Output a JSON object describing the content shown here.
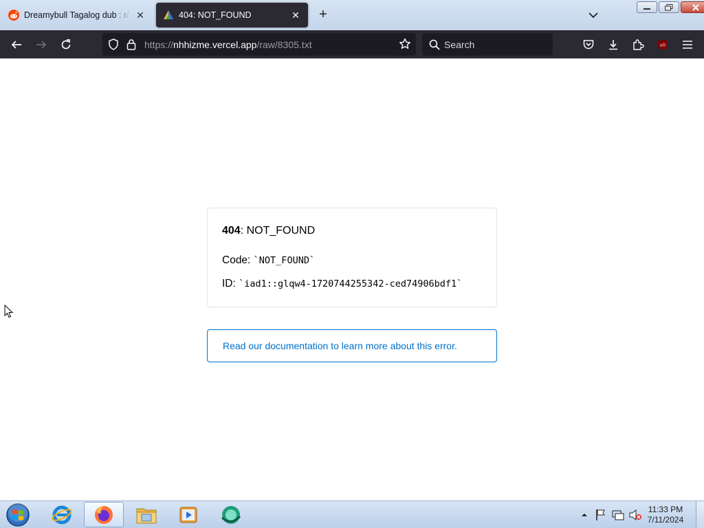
{
  "browser": {
    "tabs": [
      {
        "title": "Dreamybull Tagalog dub : r/Tha",
        "icon": "reddit-icon",
        "active": false
      },
      {
        "title": "404: NOT_FOUND",
        "icon": "vercel-favicon-icon",
        "active": true
      }
    ],
    "address": {
      "scheme": "https://",
      "host": "nhhizme.vercel.app",
      "path": "/raw/8305.txt"
    },
    "search_placeholder": "Search"
  },
  "page": {
    "error_code": "404",
    "error_name": ": NOT_FOUND",
    "code_label": "Code: ",
    "code_value": "`NOT_FOUND`",
    "id_label": "ID: ",
    "id_value": "`iad1::glqw4-1720744255342-ced74906bdf1`",
    "doc_link": "Read our documentation to learn more about this error."
  },
  "taskbar": {
    "apps": [
      "internet-explorer-icon",
      "firefox-icon",
      "file-explorer-icon",
      "media-player-icon",
      "app-icon"
    ],
    "clock_time": "11:33 PM",
    "clock_date": "7/11/2024"
  },
  "colors": {
    "accent": "#0070c9",
    "toolbar": "#2b2a33",
    "urlfield": "#1c1b22"
  }
}
